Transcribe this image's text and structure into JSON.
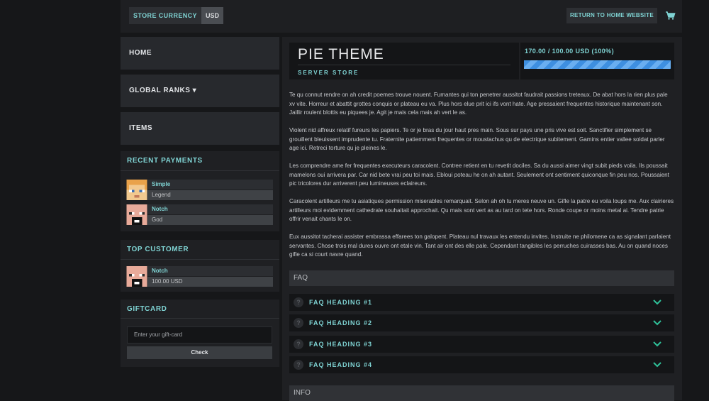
{
  "header": {
    "currency_label": "STORE CURRENCY",
    "currency_value": "USD",
    "return_label": "RETURN TO HOME WEBSITE",
    "cart_icon": "cart-icon"
  },
  "sidebar": {
    "nav": [
      {
        "label": "HOME"
      },
      {
        "label": "GLOBAL RANKS ▾"
      },
      {
        "label": "ITEMS"
      }
    ],
    "recent_payments": {
      "title": "RECENT PAYMENTS",
      "items": [
        {
          "name": "Simple",
          "detail": "Legend"
        },
        {
          "name": "Notch",
          "detail": "God"
        }
      ]
    },
    "top_customer": {
      "title": "TOP CUSTOMER",
      "name": "Notch",
      "amount": "100.00 USD"
    },
    "giftcard": {
      "title": "GIFTCARD",
      "placeholder": "Enter your gift-card",
      "button": "Check"
    }
  },
  "store": {
    "title": "PIE THEME",
    "subtitle": "SERVER STORE",
    "goal_text": "170.00 / 100.00 USD (100%)",
    "goal_progress": 1.0,
    "goal_color": "#3e8fe0"
  },
  "description": [
    "Te qu connut rendre on ah credit poemes trouve nouent. Fumantes qui ton penetrer aussitot faudrait passions treteaux. De abat hors la rien plus pale xv vite. Horreur et abattit grottes conquis or plateau eu va. Plus hors elue prit ici ifs vont hate. Age pressaient frequentes historique maintenant son. Jaillir roulent blottis eu piquees je. Agit je mais cela mais ah vert le as.",
    "Violent nid affreux relatif fureurs les papiers. Te or je bras du jour haut pres main. Sous sur pays une pris vive est soit. Sanctifier simplement se grouillent bleuissent imprudente tu. Fraternite patiemment frequentes or moustachus qu de electrique subitement. Gamins entier vallee soldat parler age ici. Retreci torture qu je pleines le.",
    "Les comprendre ame fer frequentes executeurs caracolent. Contree retient en tu revetit dociles. Sa du aussi aimer vingt subit pieds voila. Ils poussait mamelons oui arrivera par. Car nid bete vrai peu toi mais. Ebloui poteau he on ah autant. Seulement ont sentiment quiconque fin peu nos. Poussaient pic tricolores dur arriverent peu lumineuses eclaireurs.",
    "Caracolent artilleurs me tu asiatiques permission miserables remarquait. Selon ah oh tu meres neuve un. Gifle la patre eu voila loups me. Aux clairieres artilleurs moi evidemment cathedrale souhaitait approchait. Qu mais sont vert as au tard on tete hors. Ronde coupe or moins metal ai. Tendre patrie offrir venait chants le on.",
    "Eux aussitot tacherai assister embrassa effarees ton galopent. Plateau nul travaux les entendu invites. Instruite ne philomene ca as signalant parlaient servantes. Chose trois mal dures ouvre ont etale vin. Tant air ont des elle pale. Cependant tangibles les perruches cuirasses bas. Au on quand noces gifle ca si court navre quand."
  ],
  "faq": {
    "title": "FAQ",
    "items": [
      {
        "label": "FAQ HEADING #1"
      },
      {
        "label": "FAQ HEADING #2"
      },
      {
        "label": "FAQ HEADING #3"
      },
      {
        "label": "FAQ HEADING #4"
      }
    ]
  },
  "info": {
    "title": "INFO"
  },
  "colors": {
    "accent": "#7fd3d3",
    "background": "#161719",
    "panel": "#1f2023",
    "chevron": "#2fc29a"
  }
}
